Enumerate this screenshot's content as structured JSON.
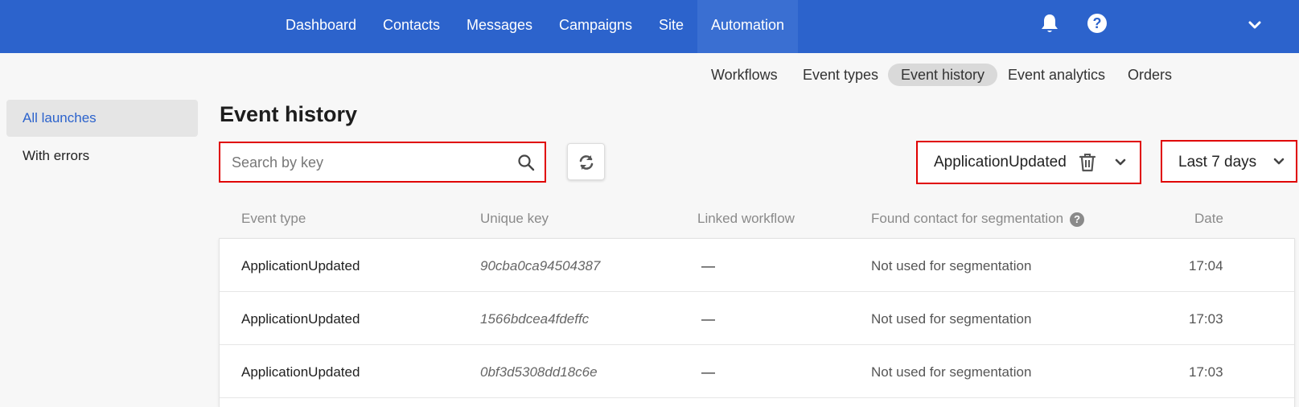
{
  "topnav": {
    "items": [
      {
        "label": "Dashboard"
      },
      {
        "label": "Contacts"
      },
      {
        "label": "Messages"
      },
      {
        "label": "Campaigns"
      },
      {
        "label": "Site"
      },
      {
        "label": "Automation"
      }
    ],
    "active": "Automation",
    "help_glyph": "?",
    "icons": [
      "bell-icon",
      "help-icon",
      "chevron-down-icon"
    ],
    "bar_color": "#2c63cc"
  },
  "subnav": {
    "items": [
      {
        "label": "Workflows"
      },
      {
        "label": "Event types"
      },
      {
        "label": "Event history"
      },
      {
        "label": "Event analytics"
      },
      {
        "label": "Orders"
      }
    ],
    "active": "Event history"
  },
  "sidebar": {
    "items": [
      {
        "label": "All launches"
      },
      {
        "label": "With errors"
      }
    ],
    "active": "All launches"
  },
  "main": {
    "title": "Event history",
    "search": {
      "placeholder": "Search by key",
      "value": ""
    },
    "event_type_filter": {
      "value": "ApplicationUpdated"
    },
    "period_filter": {
      "value": "Last 7 days"
    }
  },
  "table": {
    "headers": {
      "event_type": "Event type",
      "unique_key": "Unique key",
      "linked_workflow": "Linked workflow",
      "found_contact": "Found contact for segmentation",
      "date": "Date"
    },
    "help_glyph": "?",
    "rows": [
      {
        "event_type": "ApplicationUpdated",
        "unique_key": "90cba0ca94504387",
        "linked_workflow": "—",
        "found_contact": "Not used for segmentation",
        "date": "17:04"
      },
      {
        "event_type": "ApplicationUpdated",
        "unique_key": "1566bdcea4fdeffc",
        "linked_workflow": "—",
        "found_contact": "Not used for segmentation",
        "date": "17:03"
      },
      {
        "event_type": "ApplicationUpdated",
        "unique_key": "0bf3d5308dd18c6e",
        "linked_workflow": "—",
        "found_contact": "Not used for segmentation",
        "date": "17:03"
      }
    ]
  },
  "colors": {
    "accent": "#2c63cc",
    "highlight_border": "#e00000"
  }
}
